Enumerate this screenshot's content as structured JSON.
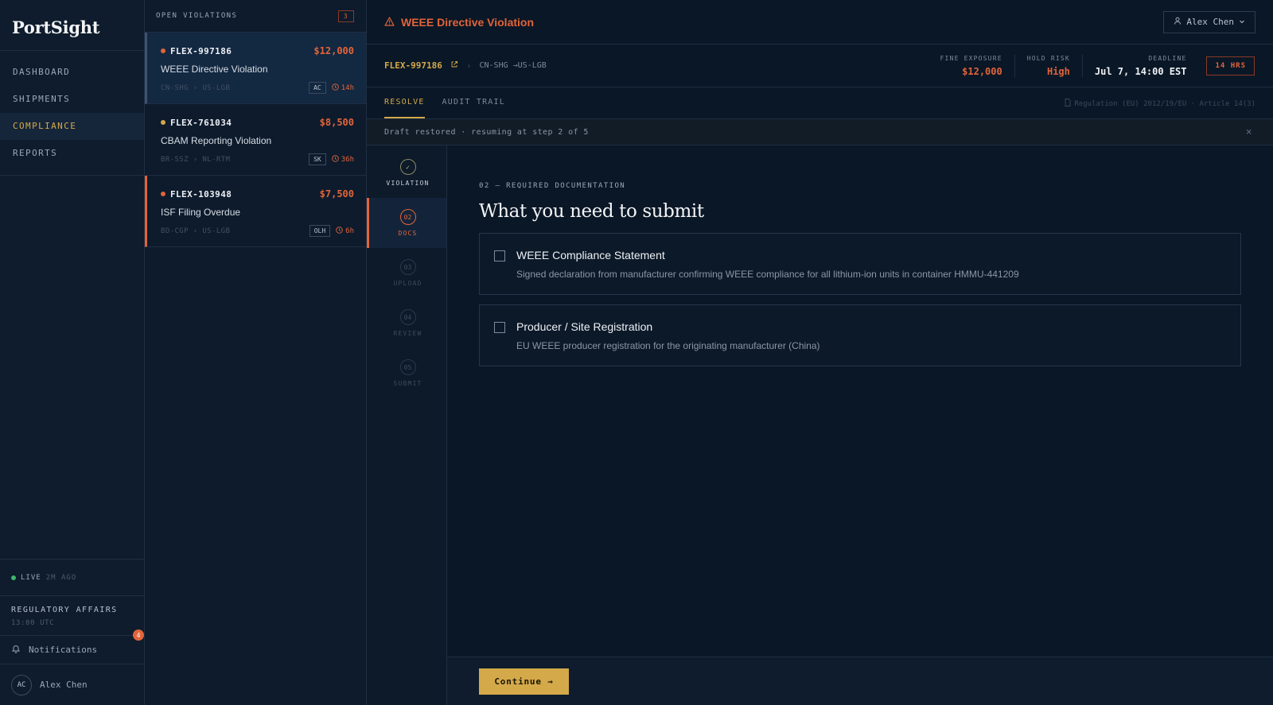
{
  "app": {
    "name": "PortSight"
  },
  "nav": {
    "items": [
      {
        "label": "DASHBOARD",
        "active": false
      },
      {
        "label": "SHIPMENTS",
        "active": false
      },
      {
        "label": "COMPLIANCE",
        "active": true
      },
      {
        "label": "REPORTS",
        "active": false
      }
    ],
    "live_label": "LIVE",
    "live_time": "2M AGO",
    "org_name": "REGULATORY AFFAIRS",
    "org_time": "13:00 UTC",
    "notifications_label": "Notifications",
    "notifications_count": "4",
    "user_initials": "AC",
    "user_name": "Alex Chen"
  },
  "violations": {
    "header": "OPEN VIOLATIONS",
    "count": "3",
    "items": [
      {
        "id": "FLEX-997186",
        "amount": "$12,000",
        "title": "WEEE Directive Violation",
        "route": "CN-SHG › US-LGB",
        "tag": "AC",
        "time": "14h",
        "severity_color": "#e2643a"
      },
      {
        "id": "FLEX-761034",
        "amount": "$8,500",
        "title": "CBAM Reporting Violation",
        "route": "BR-SSZ › NL-RTM",
        "tag": "SK",
        "time": "36h",
        "severity_color": "#d4a94a"
      },
      {
        "id": "FLEX-103948",
        "amount": "$7,500",
        "title": "ISF Filing Overdue",
        "route": "BD-CGP › US-LGB",
        "tag": "OLH",
        "time": "6h",
        "severity_color": "#e2643a"
      }
    ]
  },
  "header": {
    "title": "WEEE Directive Violation",
    "user_button": "Alex Chen"
  },
  "summary": {
    "id": "FLEX-997186",
    "route": "CN-SHG →US-LGB",
    "fine_label": "FINE EXPOSURE",
    "fine_value": "$12,000",
    "risk_label": "HOLD RISK",
    "risk_value": "High",
    "deadline_label": "DEADLINE",
    "deadline_value": "Jul 7, 14:00 EST",
    "hours_badge": "14 HRS"
  },
  "tabs": [
    {
      "label": "RESOLVE",
      "active": true
    },
    {
      "label": "AUDIT TRAIL",
      "active": false
    }
  ],
  "regulation_ref": "Regulation (EU) 2012/19/EU · Article 14(3)",
  "draft_notice": "Draft restored · resuming at step 2 of 5",
  "steps": [
    {
      "number": "✓",
      "label": "VIOLATION",
      "state": "done"
    },
    {
      "number": "02",
      "label": "DOCS",
      "state": "active"
    },
    {
      "number": "03",
      "label": "UPLOAD",
      "state": "pending"
    },
    {
      "number": "04",
      "label": "REVIEW",
      "state": "pending"
    },
    {
      "number": "05",
      "label": "SUBMIT",
      "state": "pending"
    }
  ],
  "section": {
    "kicker": "02 — REQUIRED DOCUMENTATION",
    "title": "What you need to submit",
    "documents": [
      {
        "name": "WEEE Compliance Statement",
        "description": "Signed declaration from manufacturer confirming WEEE compliance for all lithium-ion units in container HMMU-441209",
        "checked": false
      },
      {
        "name": "Producer / Site Registration",
        "description": "EU WEEE producer registration for the originating manufacturer (China)",
        "checked": false
      }
    ]
  },
  "footer": {
    "continue_label": "Continue →"
  },
  "colors": {
    "accent_gold": "#d4a94a",
    "alert_orange": "#e2643a",
    "background": "#0a1726"
  }
}
